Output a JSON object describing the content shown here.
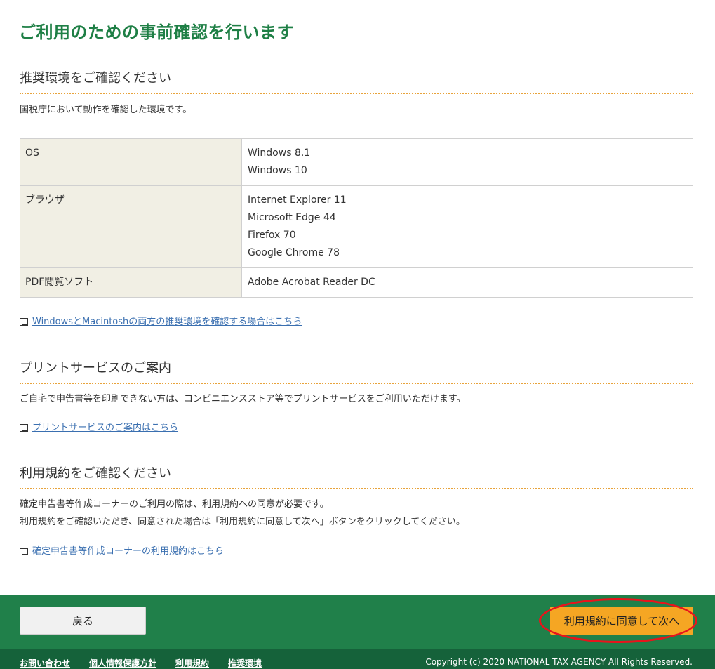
{
  "page": {
    "title": "ご利用のための事前確認を行います"
  },
  "sections": {
    "env": {
      "heading": "推奨環境をご確認ください",
      "description": "国税庁において動作を確認した環境です。",
      "table": [
        {
          "label": "OS",
          "values": [
            "Windows 8.1",
            "Windows 10"
          ]
        },
        {
          "label": "ブラウザ",
          "values": [
            "Internet Explorer 11",
            "Microsoft Edge 44",
            "Firefox 70",
            "Google Chrome 78"
          ]
        },
        {
          "label": "PDF閲覧ソフト",
          "values": [
            "Adobe Acrobat Reader DC"
          ]
        }
      ],
      "link": "WindowsとMacintoshの両方の推奨環境を確認する場合はこちら"
    },
    "print": {
      "heading": "プリントサービスのご案内",
      "description": "ご自宅で申告書等を印刷できない方は、コンビニエンスストア等でプリントサービスをご利用いただけます。",
      "link": "プリントサービスのご案内はこちら"
    },
    "terms": {
      "heading": "利用規約をご確認ください",
      "description_1": "確定申告書等作成コーナーのご利用の際は、利用規約への同意が必要です。",
      "description_2": "利用規約をご確認いただき、同意された場合は「利用規約に同意して次へ」ボタンをクリックしてください。",
      "link": "確定申告書等作成コーナーの利用規約はこちら"
    }
  },
  "actions": {
    "back_label": "戻る",
    "agree_label": "利用規約に同意して次へ"
  },
  "footer": {
    "links": [
      "お問い合わせ",
      "個人情報保護方針",
      "利用規約",
      "推奨環境"
    ],
    "copyright": "Copyright (c) 2020 NATIONAL TAX AGENCY All Rights Reserved."
  },
  "colors": {
    "brand_green": "#20804a",
    "footer_green": "#15623a",
    "accent_orange": "#f5a623",
    "link_blue": "#3a6fb0",
    "highlight_red": "#e8141c"
  },
  "icons": {
    "external_link": "new-window-icon"
  }
}
